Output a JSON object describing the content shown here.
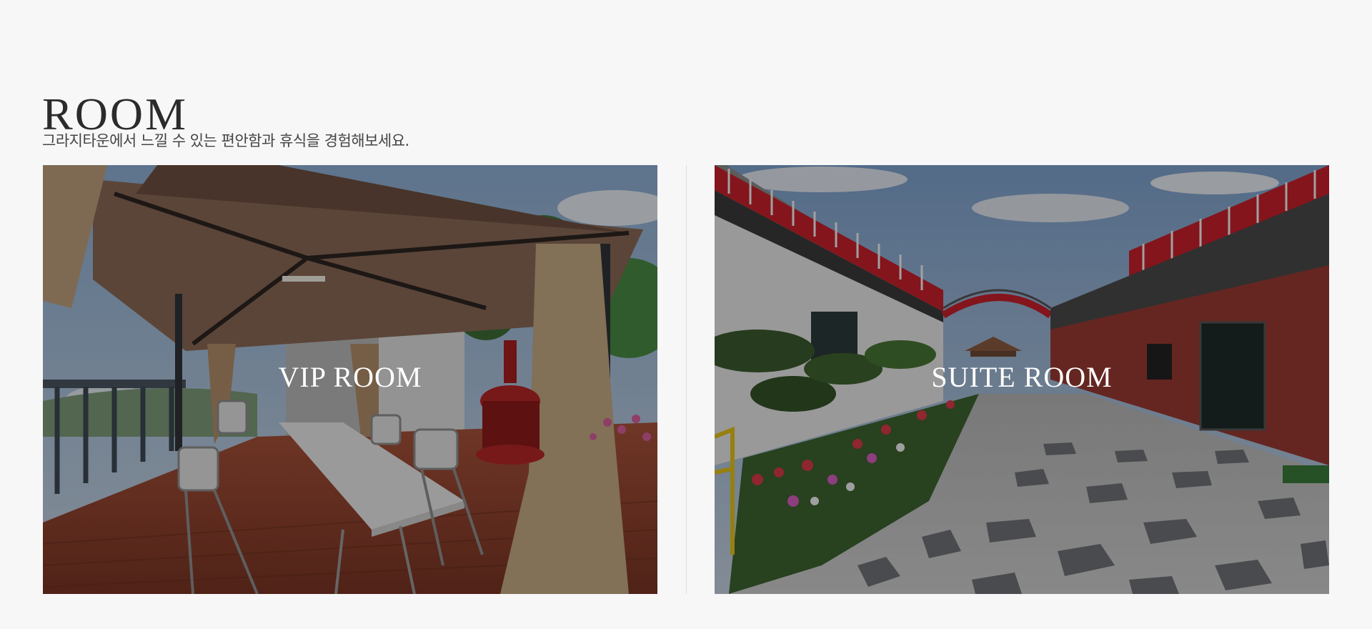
{
  "section": {
    "title": "ROOM",
    "subtitle": "그라지타운에서 느낄  수 있는 편안함과 휴식을 경험해보세요."
  },
  "rooms": [
    {
      "label": "VIP ROOM",
      "photo_icon": "gazebo-deck-photo"
    },
    {
      "label": "SUITE ROOM",
      "photo_icon": "stone-path-courtyard-photo"
    }
  ],
  "colors": {
    "background": "#f7f7f7",
    "title_text": "#2b2b2b",
    "overlay_text": "#ffffff",
    "accent_red": "#c8212b"
  }
}
